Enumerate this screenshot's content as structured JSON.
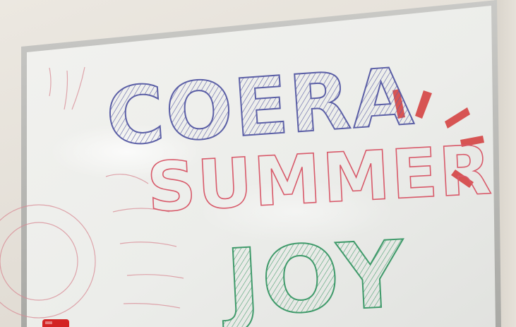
{
  "whiteboard": {
    "line1": "COERA",
    "line2": "SUMMER",
    "line3": "JOY",
    "colors": {
      "line1_ink": "#5b5fa6",
      "line2_ink": "#d85a6a",
      "line3_ink": "#3f9a6a",
      "accent_ink": "#d43a3a",
      "marker_cap": "#d32424"
    }
  },
  "objects": {
    "marker": "red-whiteboard-marker"
  }
}
